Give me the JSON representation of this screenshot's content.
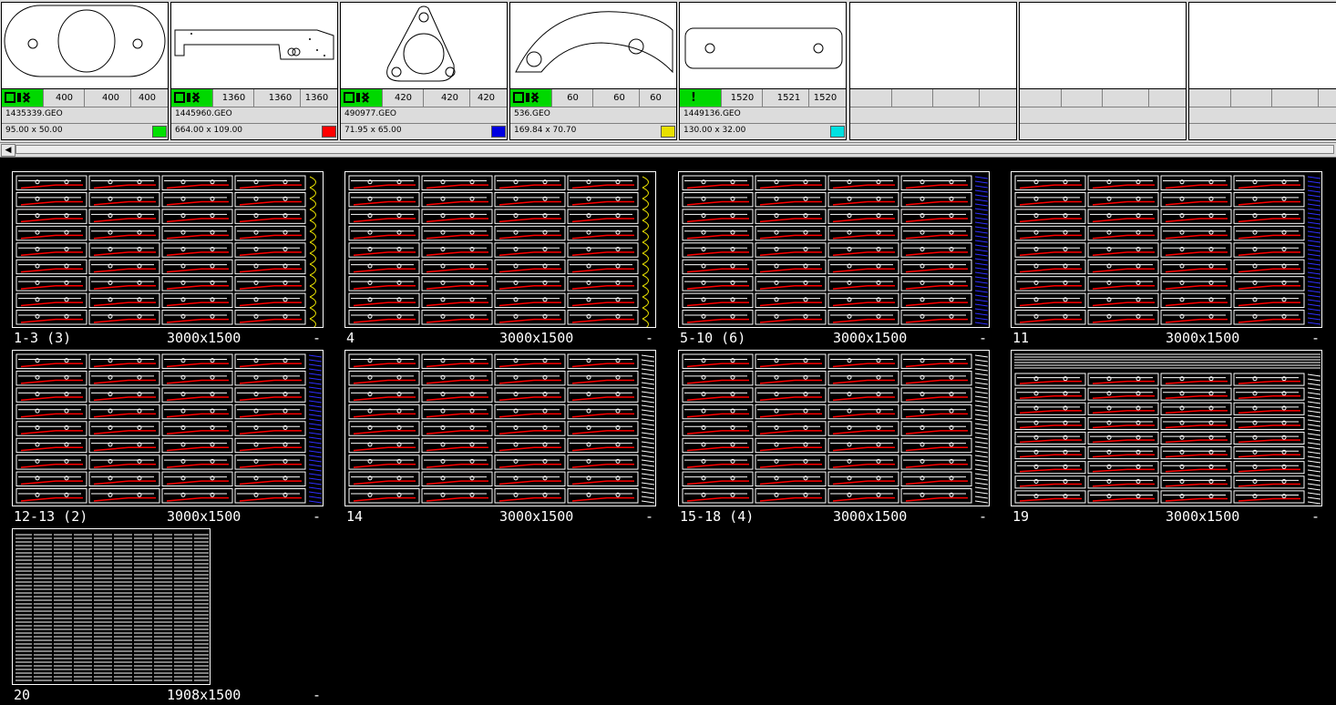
{
  "parts": [
    {
      "file": "1435339.GEO",
      "size": "95.00 x 50.00",
      "q1": "400",
      "q2": "400",
      "q3": "400",
      "status": "ok",
      "color": "#00e000",
      "shape": "oval"
    },
    {
      "file": "1445960.GEO",
      "size": "664.00 x 109.00",
      "q1": "1360",
      "q2": "1360",
      "q3": "1360",
      "status": "ok",
      "color": "#ff0000",
      "shape": "bracket"
    },
    {
      "file": "490977.GEO",
      "size": "71.95 x 65.00",
      "q1": "420",
      "q2": "420",
      "q3": "420",
      "status": "ok",
      "color": "#0000e0",
      "shape": "triangle"
    },
    {
      "file": "536.GEO",
      "size": "169.84 x 70.70",
      "q1": "60",
      "q2": "60",
      "q3": "60",
      "status": "ok",
      "color": "#e8e000",
      "shape": "arc"
    },
    {
      "file": "1449136.GEO",
      "size": "130.00 x 32.00",
      "q1": "1520",
      "q2": "1521",
      "q3": "1520",
      "status": "warn",
      "color": "#00e0e0",
      "shape": "plate"
    },
    {
      "file": "",
      "size": "",
      "q1": "",
      "q2": "",
      "q3": "",
      "status": "",
      "color": "",
      "shape": ""
    },
    {
      "file": "",
      "size": "",
      "q1": "",
      "q2": "",
      "q3": "",
      "status": "",
      "color": "",
      "shape": ""
    },
    {
      "file": "",
      "size": "",
      "q1": "",
      "q2": "",
      "q3": "",
      "status": "",
      "color": "",
      "shape": ""
    }
  ],
  "status_warn_glyph": "!",
  "scroll_left_glyph": "◀",
  "sheets": [
    {
      "id": "1-3 (3)",
      "size": "3000x1500",
      "mark": "-",
      "fill": "yellow"
    },
    {
      "id": "4",
      "size": "3000x1500",
      "mark": "-",
      "fill": "yellow"
    },
    {
      "id": "5-10 (6)",
      "size": "3000x1500",
      "mark": "-",
      "fill": "blue"
    },
    {
      "id": "11",
      "size": "3000x1500",
      "mark": "-",
      "fill": "blue"
    },
    {
      "id": "12-13 (2)",
      "size": "3000x1500",
      "mark": "-",
      "fill": "blue"
    },
    {
      "id": "14",
      "size": "3000x1500",
      "mark": "-",
      "fill": "stripes"
    },
    {
      "id": "15-18 (4)",
      "size": "3000x1500",
      "mark": "-",
      "fill": "stripes"
    },
    {
      "id": "19",
      "size": "3000x1500",
      "mark": "-",
      "fill": "stripes-top"
    },
    {
      "id": "20",
      "size": "1908x1500",
      "mark": "-",
      "fill": "dense"
    }
  ],
  "colors": {
    "part_line": "#000000",
    "sheet_outline": "#ffffff",
    "nest_red": "#ff0000",
    "nest_yellow": "#e8e000",
    "nest_blue": "#3030ff"
  }
}
